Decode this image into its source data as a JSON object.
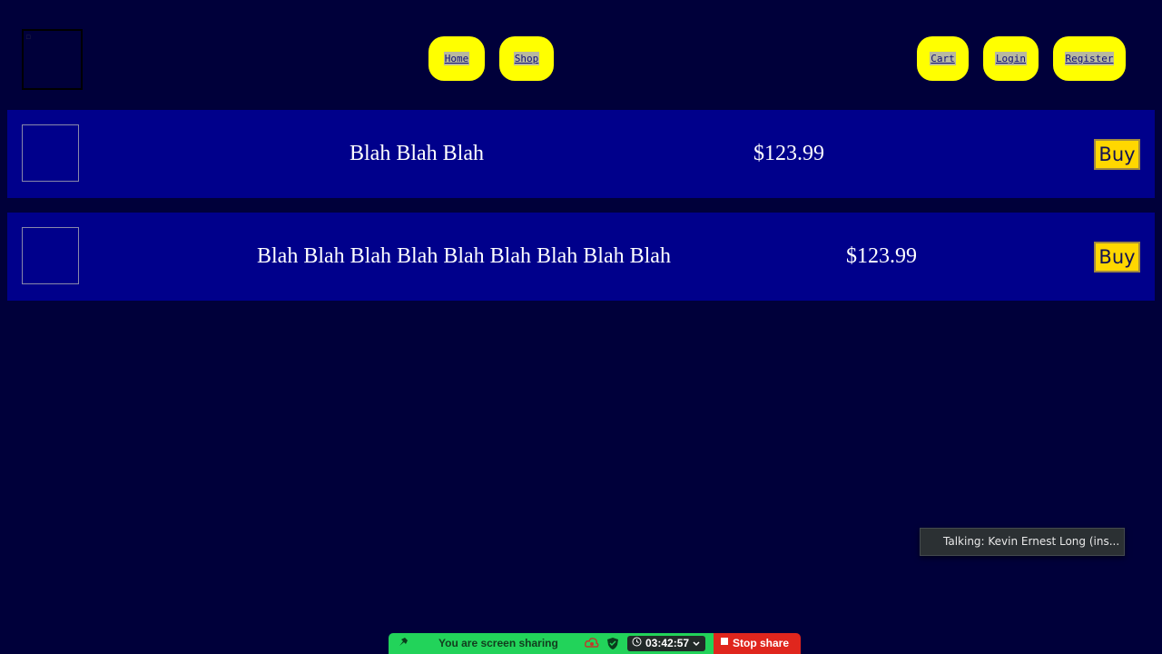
{
  "nav": {
    "home": "Home",
    "shop": "Shop",
    "cart": "Cart",
    "login": "Login",
    "register": "Register"
  },
  "products": [
    {
      "title": "Blah Blah Blah",
      "price": "$123.99",
      "buy_label": "Buy"
    },
    {
      "title": "Blah Blah Blah Blah Blah Blah Blah Blah Blah",
      "price": "$123.99",
      "buy_label": "Buy"
    }
  ],
  "talking_indicator": "Talking: Kevin Ernest Long (ins...",
  "share_bar": {
    "label": "You are screen sharing",
    "timer": "03:42:57",
    "stop_label": "Stop share"
  },
  "colors": {
    "background": "#00003a",
    "row": "#00008b",
    "nav_button": "#ffff00",
    "buy_button": "#ffd700",
    "share_green": "#22d35a",
    "stop_red": "#e0261d"
  }
}
